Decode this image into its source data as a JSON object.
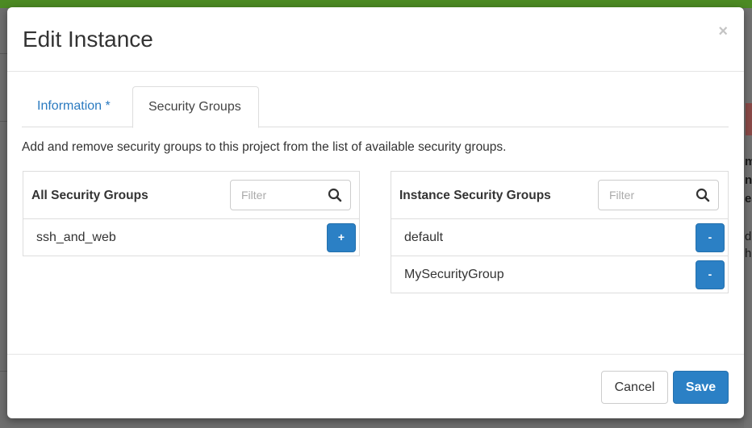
{
  "modal": {
    "title": "Edit Instance",
    "close_label": "×"
  },
  "tabs": [
    {
      "label": "Information *",
      "active": false
    },
    {
      "label": "Security Groups",
      "active": true
    }
  ],
  "description": "Add and remove security groups to this project from the list of available security groups.",
  "all_groups": {
    "title": "All Security Groups",
    "filter_placeholder": "Filter",
    "items": [
      {
        "name": "ssh_and_web",
        "action": "+"
      }
    ]
  },
  "instance_groups": {
    "title": "Instance Security Groups",
    "filter_placeholder": "Filter",
    "items": [
      {
        "name": "default",
        "action": "-"
      },
      {
        "name": "MySecurityGroup",
        "action": "-"
      }
    ]
  },
  "footer": {
    "cancel_label": "Cancel",
    "save_label": "Save"
  },
  "background": {
    "fragments": [
      "m",
      "nc",
      "ea",
      "da",
      "h"
    ]
  },
  "colors": {
    "primary": "#2b80c5",
    "link": "#2a7ac0",
    "topbar": "#4c8a23"
  }
}
